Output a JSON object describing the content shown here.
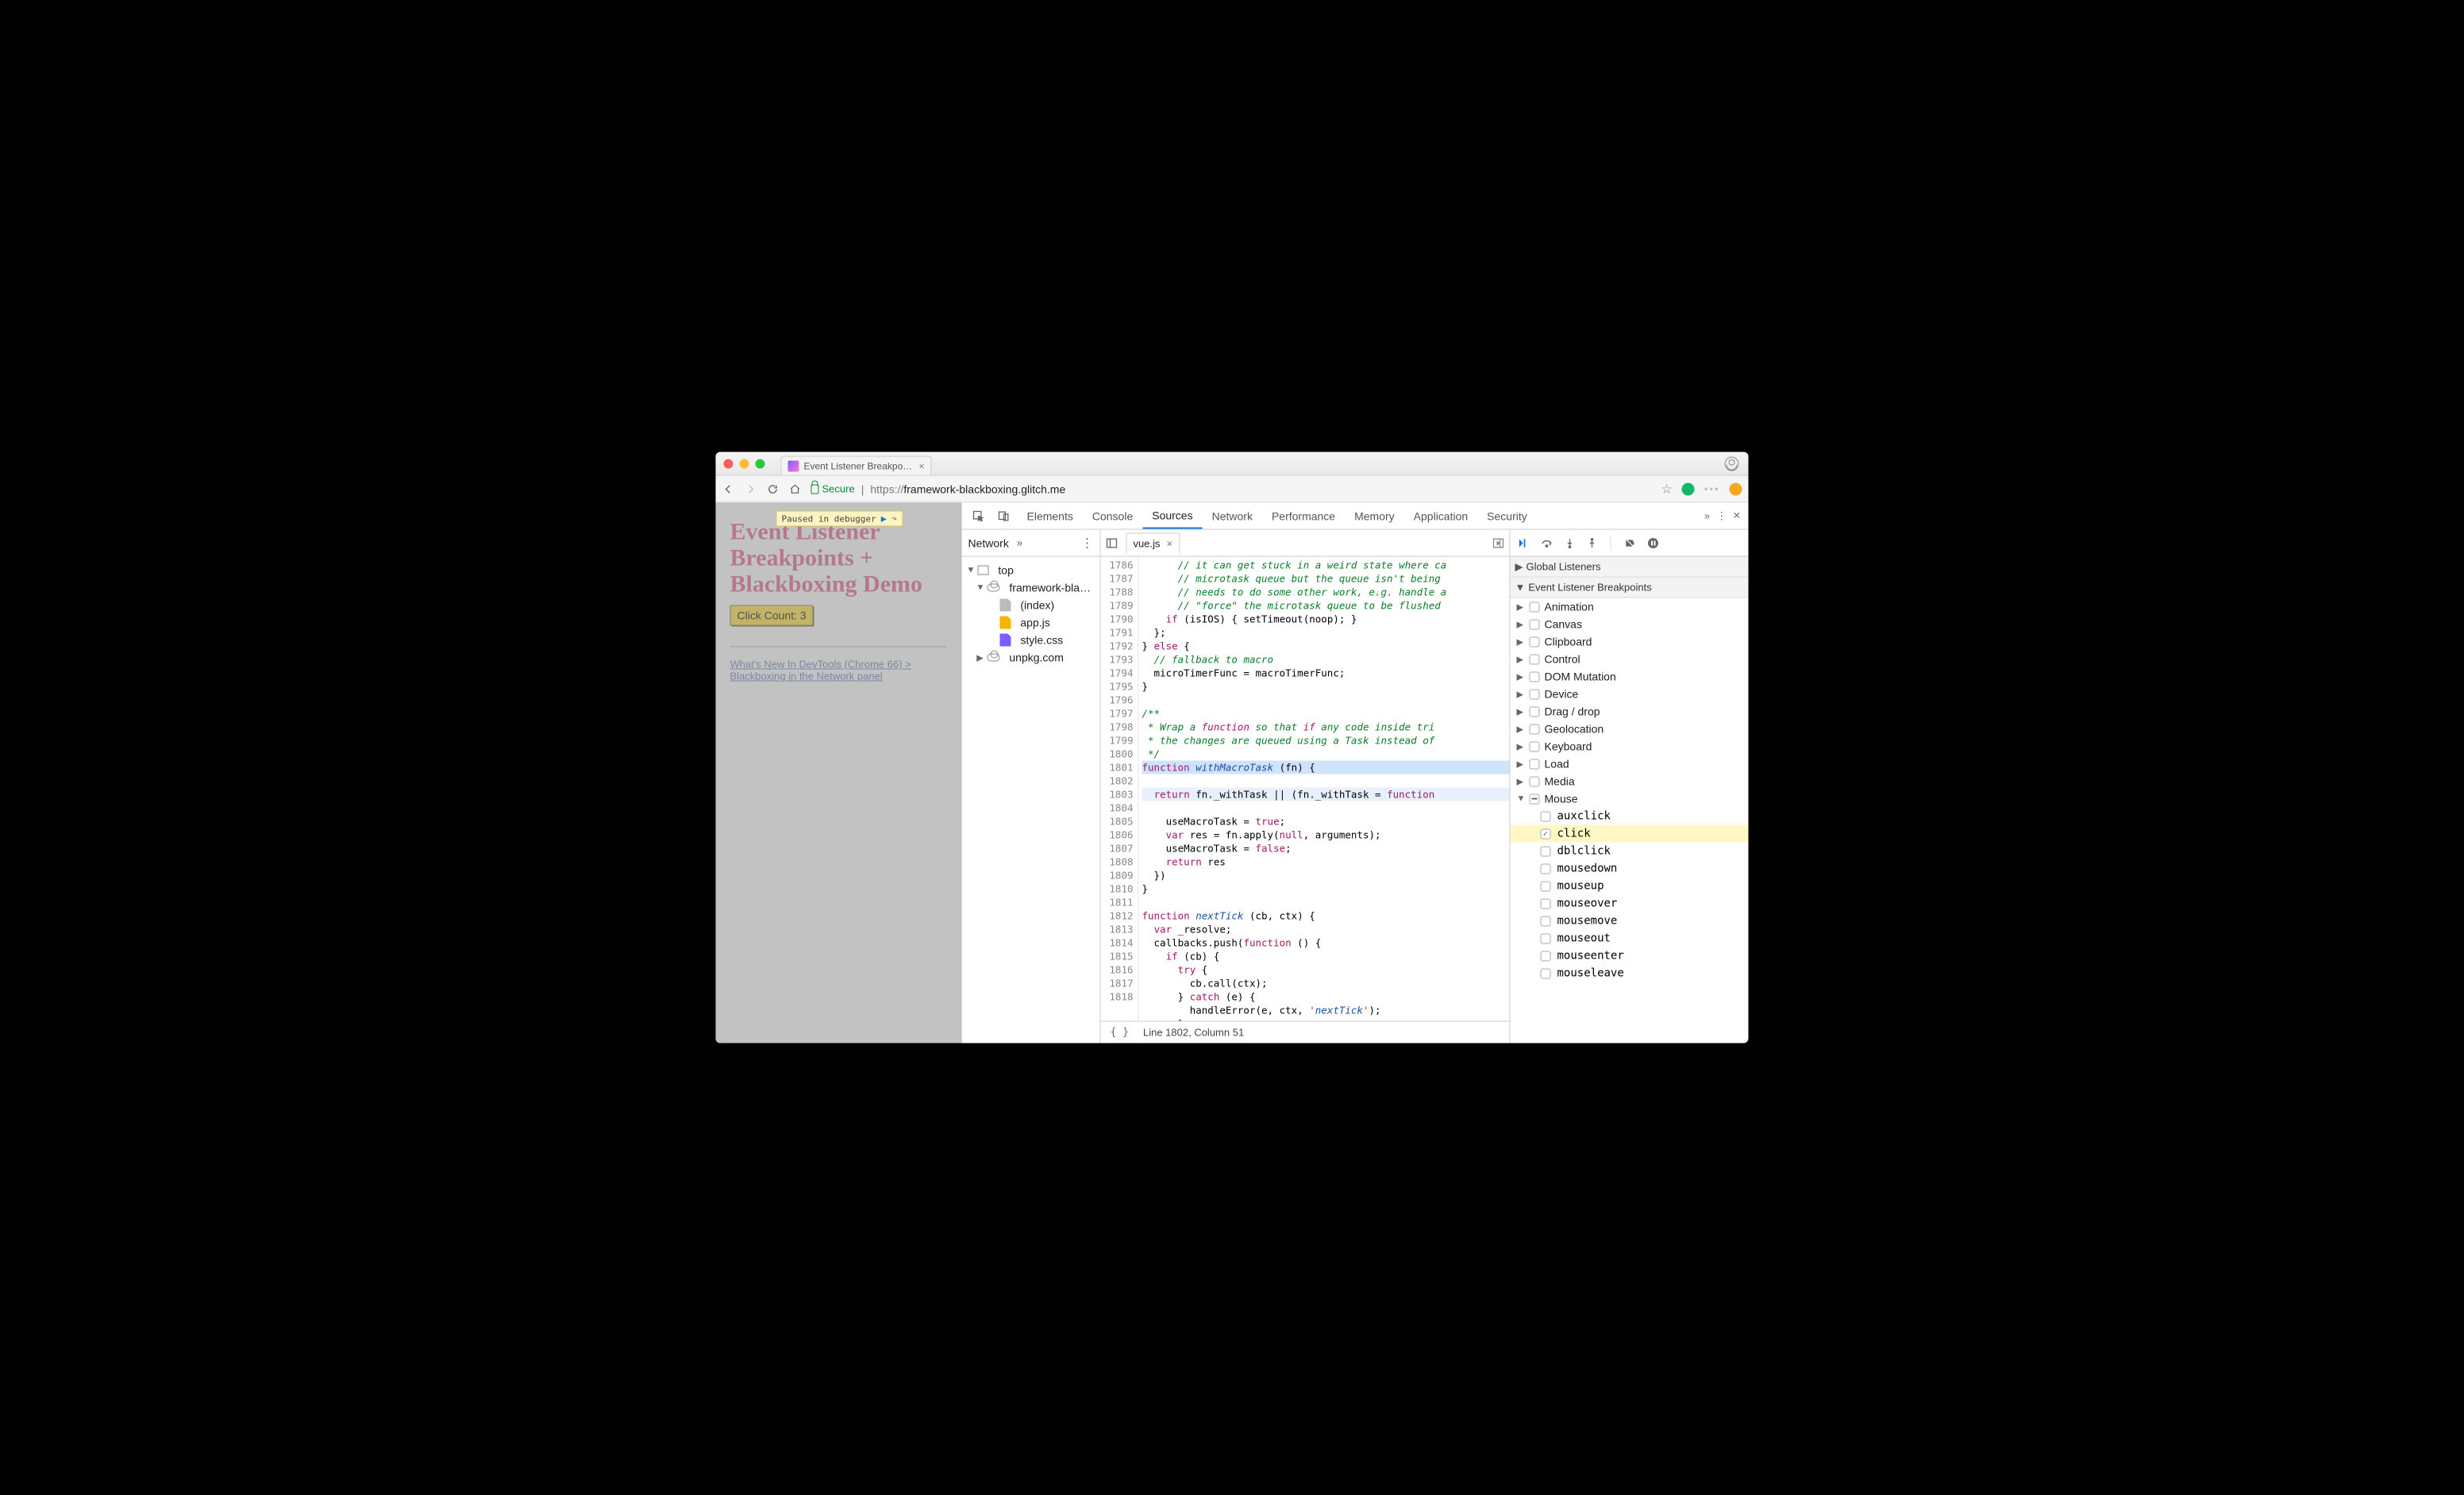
{
  "browser": {
    "tab_title": "Event Listener Breakpoints + B…",
    "secure_label": "Secure",
    "url_prefix": "https://",
    "url_host": "framework-blackboxing.glitch.me",
    "star": "☆"
  },
  "page": {
    "pause_text": "Paused in debugger",
    "title_html": "Event Listener Breakpoints + Blackboxing Demo",
    "click_label": "Click Count: 3",
    "link_text": "What's New In DevTools (Chrome 66) > Blackboxing in the Network panel"
  },
  "dt": {
    "tabs": [
      "Elements",
      "Console",
      "Sources",
      "Network",
      "Performance",
      "Memory",
      "Application",
      "Security"
    ],
    "selected_tab": "Sources"
  },
  "nav": {
    "header": "Network",
    "top": "top",
    "host": "framework-bla…",
    "files": [
      "(index)",
      "app.js",
      "style.css"
    ],
    "other": "unpkg.com"
  },
  "editor": {
    "tab": "vue.js",
    "first_line": 1786,
    "lines": [
      "      // it can get stuck in a weird state where ca",
      "      // microtask queue but the queue isn't being",
      "      // needs to do some other work, e.g. handle a",
      "      // \"force\" the microtask queue to be flushed",
      "    if (isIOS) { setTimeout(noop); }",
      "  };",
      "} else {",
      "  // fallback to macro",
      "  microTimerFunc = macroTimerFunc;",
      "}",
      "",
      "/**",
      " * Wrap a function so that if any code inside tri",
      " * the changes are queued using a Task instead of",
      " */",
      "function withMacroTask (fn) {",
      "  return fn._withTask || (fn._withTask = function",
      "    useMacroTask = true;",
      "    var res = fn.apply(null, arguments);",
      "    useMacroTask = false;",
      "    return res",
      "  })",
      "} ",
      "",
      "function nextTick (cb, ctx) {",
      "  var _resolve;",
      "  callbacks.push(function () {",
      "    if (cb) {",
      "      try {",
      "        cb.call(ctx);",
      "      } catch (e) {",
      "        handleError(e, ctx, 'nextTick');",
      "      }"
    ],
    "status": "Line 1802, Column 51"
  },
  "rpanel": {
    "global": "Global Listeners",
    "elb": "Event Listener Breakpoints",
    "cats": [
      "Animation",
      "Canvas",
      "Clipboard",
      "Control",
      "DOM Mutation",
      "Device",
      "Drag / drop",
      "Geolocation",
      "Keyboard",
      "Load",
      "Media"
    ],
    "mouse_label": "Mouse",
    "mouse": [
      "auxclick",
      "click",
      "dblclick",
      "mousedown",
      "mouseup",
      "mouseover",
      "mousemove",
      "mouseout",
      "mouseenter",
      "mouseleave"
    ],
    "checked": "click"
  }
}
